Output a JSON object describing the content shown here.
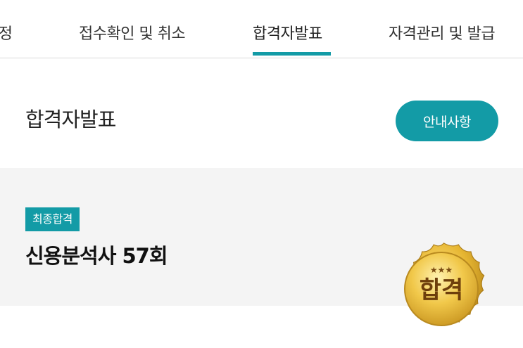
{
  "tabs": [
    {
      "label": "일정"
    },
    {
      "label": "접수확인 및 취소"
    },
    {
      "label": "합격자발표",
      "active": true
    },
    {
      "label": "자격관리 및 발급"
    }
  ],
  "header": {
    "title": "합격자발표",
    "guide_button": "안내사항"
  },
  "result": {
    "badge": "최종합격",
    "exam_name": "신용분석사 57회",
    "seal_text": "합격",
    "seal_stars": "★★★"
  },
  "colors": {
    "accent": "#139ba6",
    "section_bg": "#f4f4f4",
    "seal_gold": "#d9a626"
  },
  "icons": [
    "pass-seal-icon"
  ]
}
